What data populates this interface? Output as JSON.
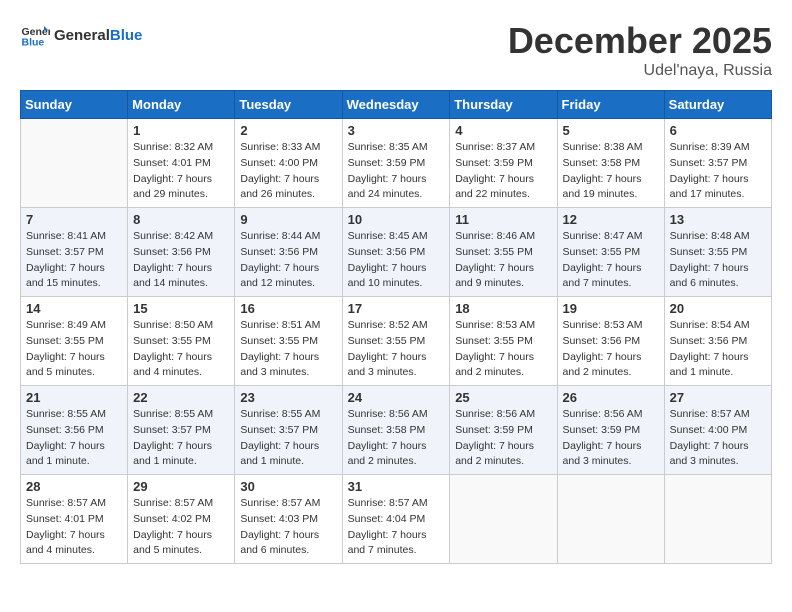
{
  "header": {
    "logo_line1": "General",
    "logo_line2": "Blue",
    "month": "December 2025",
    "location": "Udel'naya, Russia"
  },
  "weekdays": [
    "Sunday",
    "Monday",
    "Tuesday",
    "Wednesday",
    "Thursday",
    "Friday",
    "Saturday"
  ],
  "weeks": [
    [
      {
        "day": "",
        "info": ""
      },
      {
        "day": "1",
        "info": "Sunrise: 8:32 AM\nSunset: 4:01 PM\nDaylight: 7 hours\nand 29 minutes."
      },
      {
        "day": "2",
        "info": "Sunrise: 8:33 AM\nSunset: 4:00 PM\nDaylight: 7 hours\nand 26 minutes."
      },
      {
        "day": "3",
        "info": "Sunrise: 8:35 AM\nSunset: 3:59 PM\nDaylight: 7 hours\nand 24 minutes."
      },
      {
        "day": "4",
        "info": "Sunrise: 8:37 AM\nSunset: 3:59 PM\nDaylight: 7 hours\nand 22 minutes."
      },
      {
        "day": "5",
        "info": "Sunrise: 8:38 AM\nSunset: 3:58 PM\nDaylight: 7 hours\nand 19 minutes."
      },
      {
        "day": "6",
        "info": "Sunrise: 8:39 AM\nSunset: 3:57 PM\nDaylight: 7 hours\nand 17 minutes."
      }
    ],
    [
      {
        "day": "7",
        "info": "Sunrise: 8:41 AM\nSunset: 3:57 PM\nDaylight: 7 hours\nand 15 minutes."
      },
      {
        "day": "8",
        "info": "Sunrise: 8:42 AM\nSunset: 3:56 PM\nDaylight: 7 hours\nand 14 minutes."
      },
      {
        "day": "9",
        "info": "Sunrise: 8:44 AM\nSunset: 3:56 PM\nDaylight: 7 hours\nand 12 minutes."
      },
      {
        "day": "10",
        "info": "Sunrise: 8:45 AM\nSunset: 3:56 PM\nDaylight: 7 hours\nand 10 minutes."
      },
      {
        "day": "11",
        "info": "Sunrise: 8:46 AM\nSunset: 3:55 PM\nDaylight: 7 hours\nand 9 minutes."
      },
      {
        "day": "12",
        "info": "Sunrise: 8:47 AM\nSunset: 3:55 PM\nDaylight: 7 hours\nand 7 minutes."
      },
      {
        "day": "13",
        "info": "Sunrise: 8:48 AM\nSunset: 3:55 PM\nDaylight: 7 hours\nand 6 minutes."
      }
    ],
    [
      {
        "day": "14",
        "info": "Sunrise: 8:49 AM\nSunset: 3:55 PM\nDaylight: 7 hours\nand 5 minutes."
      },
      {
        "day": "15",
        "info": "Sunrise: 8:50 AM\nSunset: 3:55 PM\nDaylight: 7 hours\nand 4 minutes."
      },
      {
        "day": "16",
        "info": "Sunrise: 8:51 AM\nSunset: 3:55 PM\nDaylight: 7 hours\nand 3 minutes."
      },
      {
        "day": "17",
        "info": "Sunrise: 8:52 AM\nSunset: 3:55 PM\nDaylight: 7 hours\nand 3 minutes."
      },
      {
        "day": "18",
        "info": "Sunrise: 8:53 AM\nSunset: 3:55 PM\nDaylight: 7 hours\nand 2 minutes."
      },
      {
        "day": "19",
        "info": "Sunrise: 8:53 AM\nSunset: 3:56 PM\nDaylight: 7 hours\nand 2 minutes."
      },
      {
        "day": "20",
        "info": "Sunrise: 8:54 AM\nSunset: 3:56 PM\nDaylight: 7 hours\nand 1 minute."
      }
    ],
    [
      {
        "day": "21",
        "info": "Sunrise: 8:55 AM\nSunset: 3:56 PM\nDaylight: 7 hours\nand 1 minute."
      },
      {
        "day": "22",
        "info": "Sunrise: 8:55 AM\nSunset: 3:57 PM\nDaylight: 7 hours\nand 1 minute."
      },
      {
        "day": "23",
        "info": "Sunrise: 8:55 AM\nSunset: 3:57 PM\nDaylight: 7 hours\nand 1 minute."
      },
      {
        "day": "24",
        "info": "Sunrise: 8:56 AM\nSunset: 3:58 PM\nDaylight: 7 hours\nand 2 minutes."
      },
      {
        "day": "25",
        "info": "Sunrise: 8:56 AM\nSunset: 3:59 PM\nDaylight: 7 hours\nand 2 minutes."
      },
      {
        "day": "26",
        "info": "Sunrise: 8:56 AM\nSunset: 3:59 PM\nDaylight: 7 hours\nand 3 minutes."
      },
      {
        "day": "27",
        "info": "Sunrise: 8:57 AM\nSunset: 4:00 PM\nDaylight: 7 hours\nand 3 minutes."
      }
    ],
    [
      {
        "day": "28",
        "info": "Sunrise: 8:57 AM\nSunset: 4:01 PM\nDaylight: 7 hours\nand 4 minutes."
      },
      {
        "day": "29",
        "info": "Sunrise: 8:57 AM\nSunset: 4:02 PM\nDaylight: 7 hours\nand 5 minutes."
      },
      {
        "day": "30",
        "info": "Sunrise: 8:57 AM\nSunset: 4:03 PM\nDaylight: 7 hours\nand 6 minutes."
      },
      {
        "day": "31",
        "info": "Sunrise: 8:57 AM\nSunset: 4:04 PM\nDaylight: 7 hours\nand 7 minutes."
      },
      {
        "day": "",
        "info": ""
      },
      {
        "day": "",
        "info": ""
      },
      {
        "day": "",
        "info": ""
      }
    ]
  ]
}
